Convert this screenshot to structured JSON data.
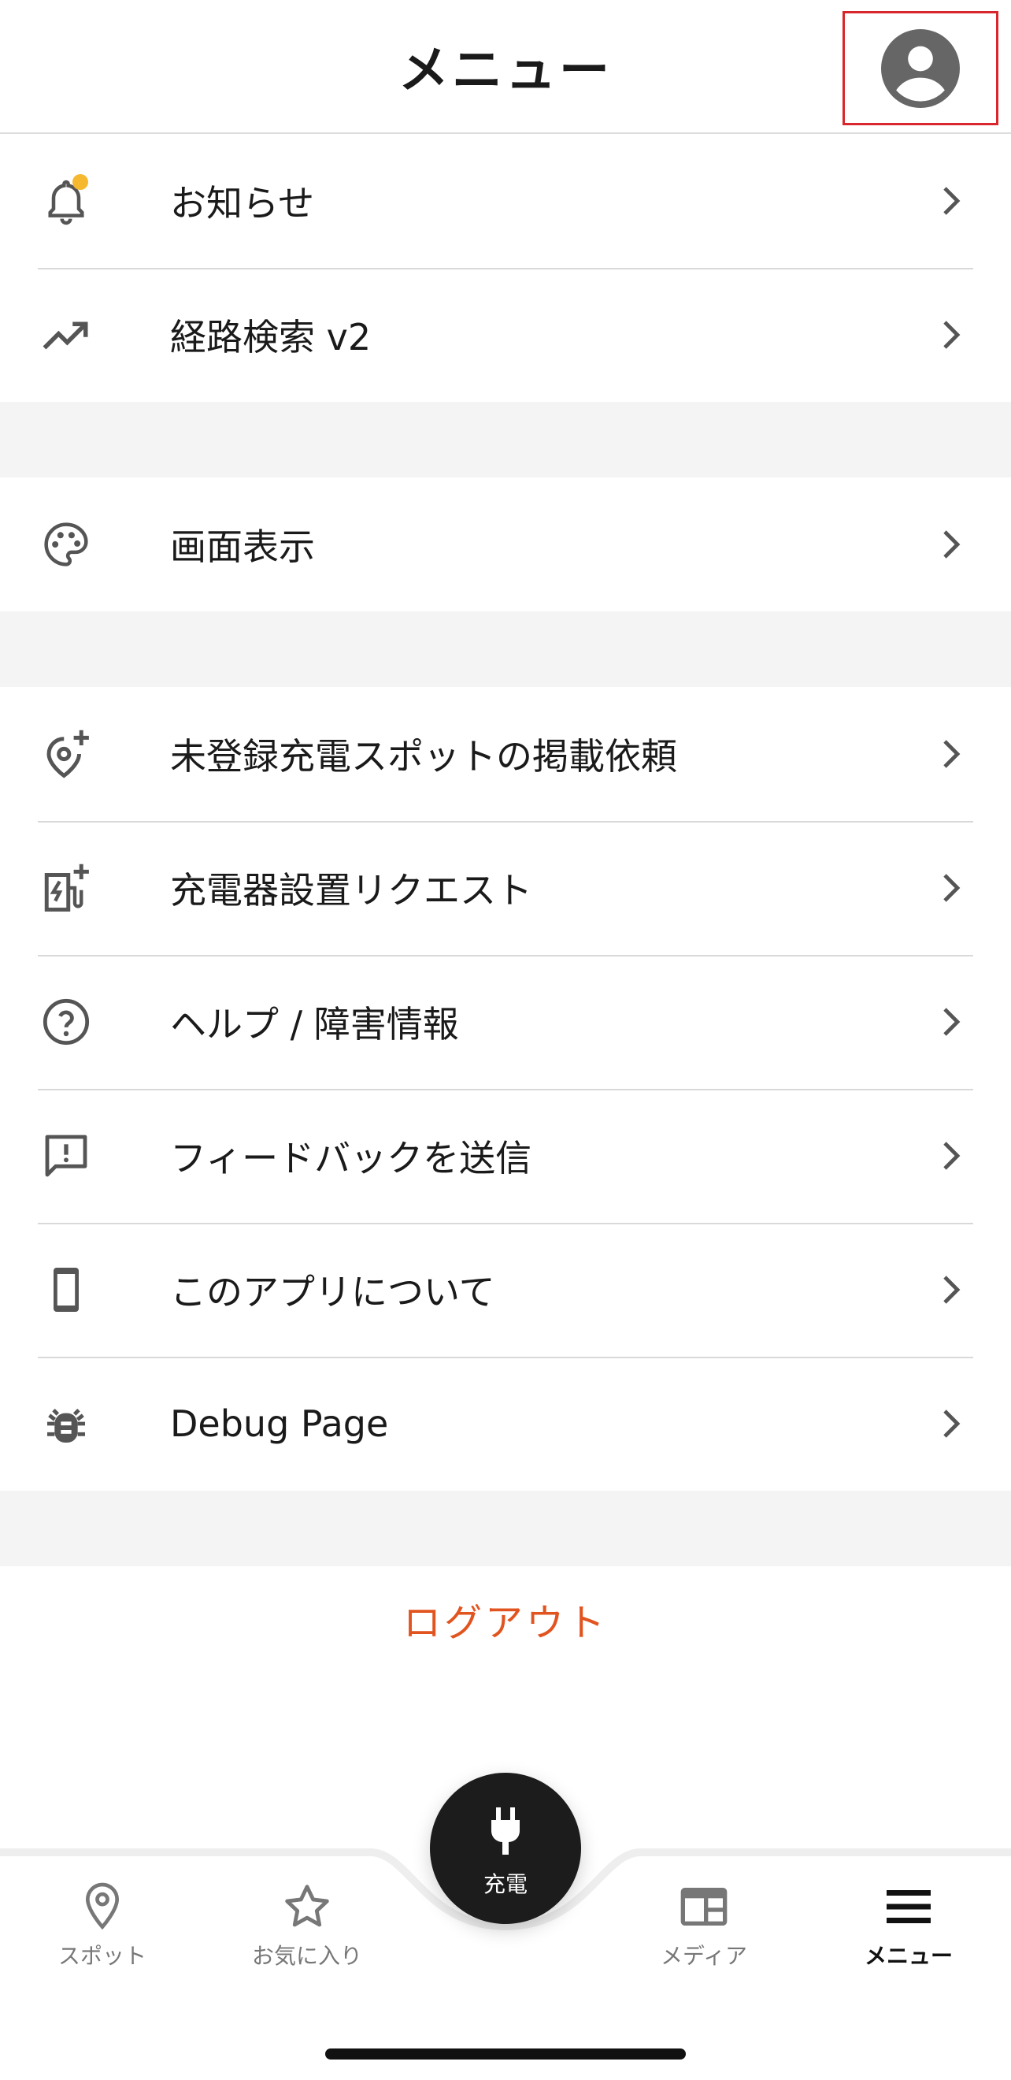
{
  "header": {
    "title": "メニュー",
    "profile_icon": "account-circle-icon"
  },
  "section1": [
    {
      "label": "お知らせ",
      "icon": "bell-icon",
      "badge_color": "#f5b82e"
    },
    {
      "label": "経路検索 v2",
      "icon": "trending-up-icon"
    }
  ],
  "section2": [
    {
      "label": "画面表示",
      "icon": "palette-icon"
    }
  ],
  "section3": [
    {
      "label": "未登録充電スポットの掲載依頼",
      "icon": "add-location-icon"
    },
    {
      "label": "充電器設置リクエスト",
      "icon": "ev-charger-add-icon"
    },
    {
      "label": "ヘルプ / 障害情報",
      "icon": "help-circle-icon"
    },
    {
      "label": "フィードバックを送信",
      "icon": "feedback-icon"
    },
    {
      "label": "このアプリについて",
      "icon": "smartphone-icon"
    },
    {
      "label": "Debug Page",
      "icon": "bug-icon"
    }
  ],
  "logout_label": "ログアウト",
  "tabs": {
    "spot": "スポット",
    "favorites": "お気に入り",
    "charge": "充電",
    "media": "メディア",
    "menu": "メニュー"
  },
  "colors": {
    "accent": "#e2541f",
    "badge": "#f5b82e",
    "fab": "#1c1c1c"
  }
}
